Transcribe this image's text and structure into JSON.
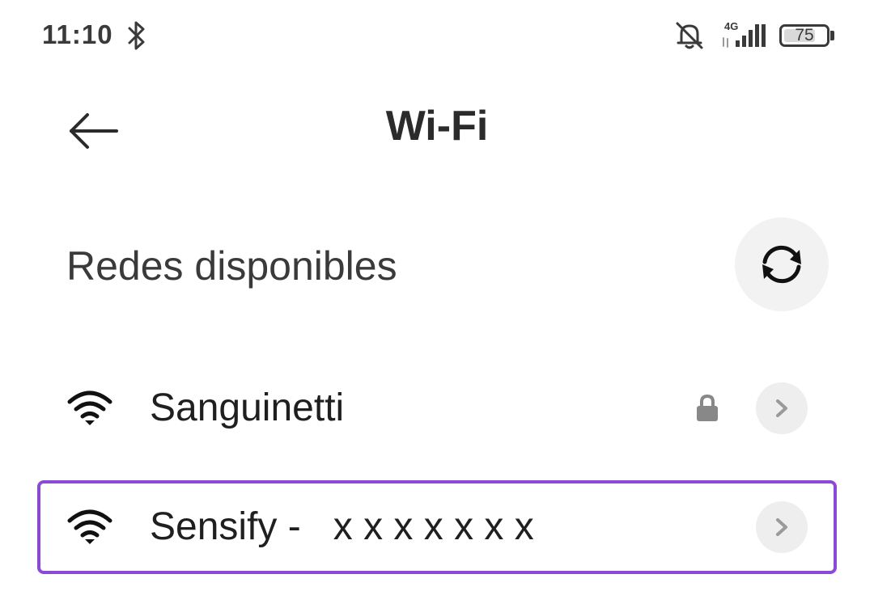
{
  "status_bar": {
    "time": "11:10",
    "network_type": "4G",
    "battery_level": "75",
    "battery_fraction": 0.75
  },
  "header": {
    "title": "Wi-Fi"
  },
  "section": {
    "title": "Redes disponibles"
  },
  "networks": [
    {
      "name": "Sanguinetti",
      "secured": true,
      "selected": false
    },
    {
      "name": "Sensify -   x x x x x x x",
      "secured": false,
      "selected": true
    }
  ],
  "colors": {
    "selection_border": "#8b4ad6",
    "refresh_button_bg": "#f2f2f2",
    "chevron_button_bg": "#eeeeee"
  },
  "icons": {
    "status": [
      "bluetooth-icon",
      "notifications-muted-icon",
      "cellular-signal-icon",
      "battery-icon"
    ],
    "header": [
      "back-arrow-icon"
    ],
    "section": [
      "refresh-icon"
    ],
    "rows": [
      "wifi-signal-icon",
      "lock-icon",
      "chevron-right-icon"
    ]
  }
}
